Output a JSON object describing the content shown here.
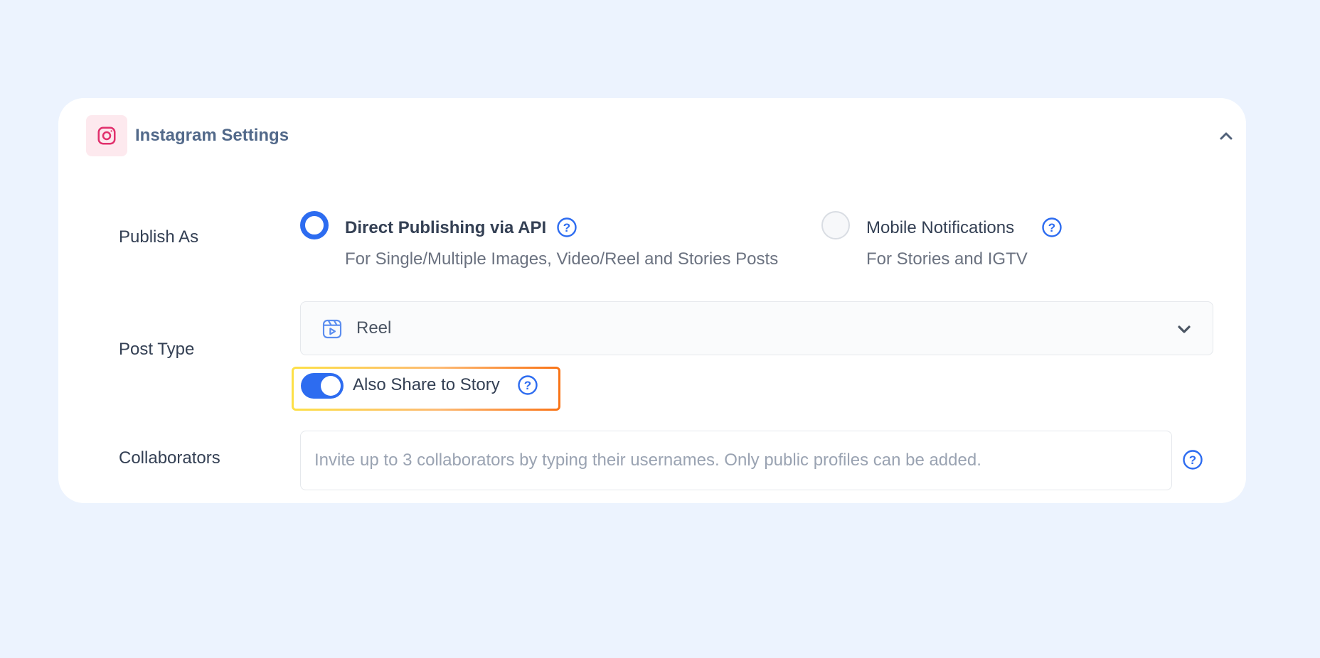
{
  "header": {
    "title": "Instagram Settings",
    "icon": "instagram-icon",
    "collapse_icon": "chevron-up-icon"
  },
  "publish_as": {
    "label": "Publish As",
    "options": [
      {
        "title": "Direct Publishing via API",
        "subtitle": "For Single/Multiple Images, Video/Reel and Stories Posts",
        "selected": true
      },
      {
        "title": "Mobile Notifications",
        "subtitle": "For Stories and IGTV",
        "selected": false
      }
    ]
  },
  "post_type": {
    "label": "Post Type",
    "selected_value": "Reel",
    "icon": "reel-icon",
    "share_to_story": {
      "label": "Also Share to Story",
      "enabled": true
    }
  },
  "collaborators": {
    "label": "Collaborators",
    "placeholder": "Invite up to 3 collaborators by typing their usernames. Only public profiles can be added."
  },
  "colors": {
    "accent": "#2d6cf0",
    "background": "#ecf3fe",
    "instagram": "#e1306c",
    "highlight_start": "#fde047",
    "highlight_end": "#f97316"
  }
}
